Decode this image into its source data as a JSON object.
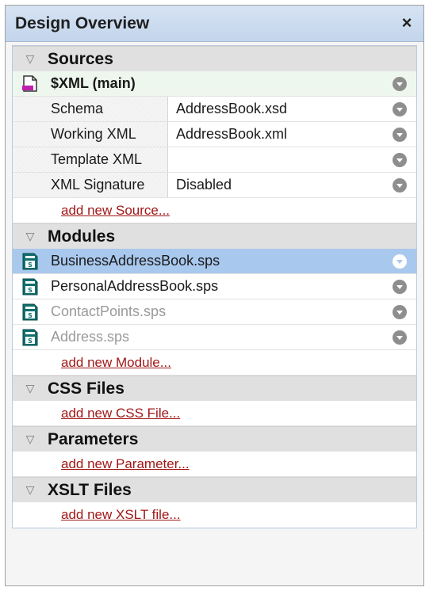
{
  "window": {
    "title": "Design Overview",
    "close_glyph": "×"
  },
  "sections": {
    "sources": {
      "title": "Sources",
      "main_label": "$XML (main)",
      "props": [
        {
          "key": "Schema",
          "value": "AddressBook.xsd"
        },
        {
          "key": "Working XML",
          "value": "AddressBook.xml"
        },
        {
          "key": "Template XML",
          "value": ""
        },
        {
          "key": "XML Signature",
          "value": "Disabled"
        }
      ],
      "add_link": "add new Source..."
    },
    "modules": {
      "title": "Modules",
      "items": [
        {
          "label": "BusinessAddressBook.sps",
          "state": "selected"
        },
        {
          "label": "PersonalAddressBook.sps",
          "state": "normal"
        },
        {
          "label": "ContactPoints.sps",
          "state": "dimmed"
        },
        {
          "label": "Address.sps",
          "state": "dimmed"
        }
      ],
      "add_link": "add new Module..."
    },
    "css": {
      "title": "CSS Files",
      "add_link": "add new CSS File..."
    },
    "parameters": {
      "title": "Parameters",
      "add_link": "add new Parameter..."
    },
    "xslt": {
      "title": "XSLT Files",
      "add_link": "add new XSLT file..."
    }
  },
  "icons": {
    "collapse": "collapse-triangle-icon",
    "xml_source": "xml-file-icon",
    "module": "sps-module-icon",
    "menu": "dropdown-circle-icon"
  },
  "colors": {
    "title_bar": "#c3d5ec",
    "selected_row": "#a9c8ee",
    "main_source_row": "#eef7ee",
    "link": "#a01818",
    "module_icon": "#0f6f6f",
    "xml_icon_accent": "#c020b0"
  }
}
